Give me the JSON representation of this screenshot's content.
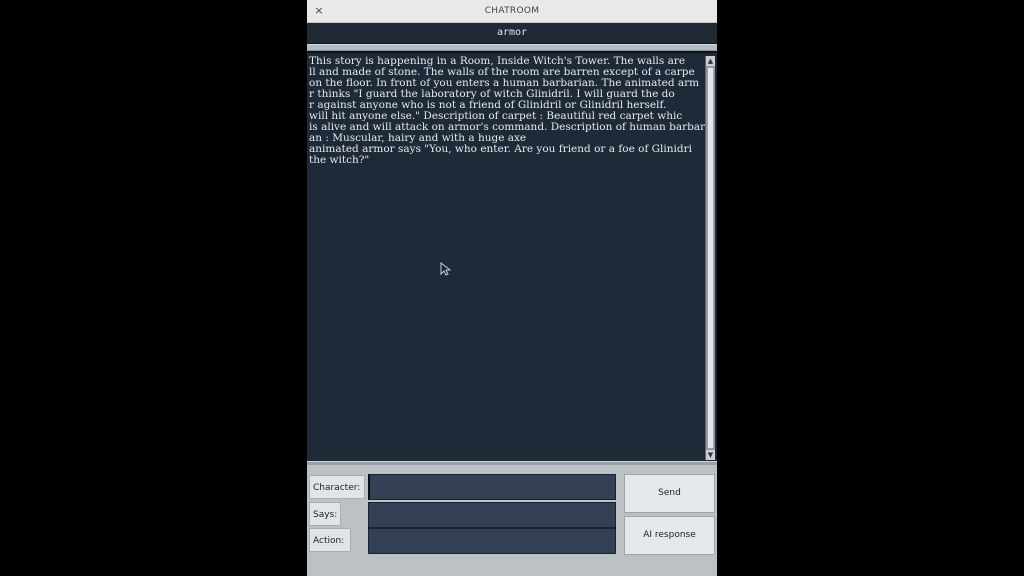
{
  "window": {
    "title": "CHATROOM",
    "close_glyph": "×"
  },
  "room": {
    "name": "armor"
  },
  "chat": {
    "lines": [
      "This story is happening in a Room, Inside Witch's Tower. The walls are ",
      "ll and made of stone. The walls of the room are barren except of a carpe",
      "on the floor. In front of you enters a human barbarian. The animated arm",
      "r thinks \"I guard the laboratory of witch Glinidril. I will guard the do",
      "r against anyone who is not a friend of Glinidril or Glinidril herself. ",
      "will hit anyone else.\" Description of carpet : Beautiful red carpet whic",
      "is alive and will attack on armor's command. Description of human barbar",
      "an : Muscular, hairy and with a huge axe",
      "animated armor says \"You, who enter. Are you friend or a foe of Glinidri",
      "the witch?\""
    ]
  },
  "form": {
    "character_label": "Character:",
    "says_label": "Says:",
    "action_label": "Action:",
    "character_value": "",
    "says_value": "",
    "action_value": ""
  },
  "buttons": {
    "send_label": "Send",
    "ai_label": "AI response"
  },
  "icons": {
    "close": "close-icon",
    "scroll_up": "scroll-up-arrow-icon",
    "scroll_down": "scroll-down-arrow-icon",
    "cursor": "mouse-pointer-icon"
  },
  "colors": {
    "chat_background": "#1f2a38",
    "chat_text": "#e6e9ed",
    "input_background": "#334055",
    "panel_background": "#bcc1c6"
  }
}
